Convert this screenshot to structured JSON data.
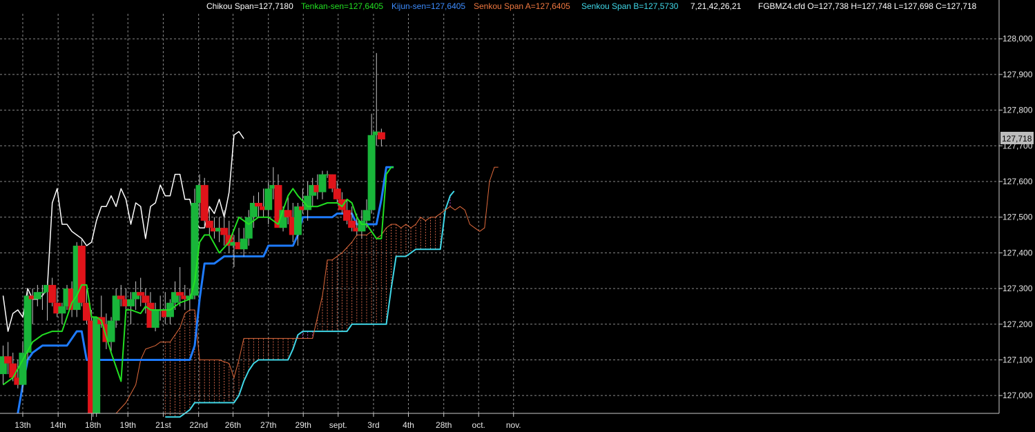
{
  "header": {
    "chikou": "Chikou Span=127,7180",
    "tenkan": "Tenkan-sen=127,6405",
    "kijun": "Kijun-sen=127,6405",
    "senkou_a": "Senkou Span A=127,6405",
    "senkou_b": "Senkou Span B=127,5730",
    "params": "7,21,42,26,21",
    "ohlc": "FGBMZ4.cfd O=127,738 H=127,748 L=127,698 C=127,718"
  },
  "last_price_label": "127,718",
  "colors": {
    "background": "#000000",
    "grid": "#8a8a8a",
    "bull": "#19b53a",
    "bear": "#e0141a",
    "chikou": "#ffffff",
    "tenkan": "#22e022",
    "kijun": "#1e7bff",
    "senkou_a": "#e06a3c",
    "senkou_b": "#40d8e8",
    "cloud_hatch_a": "#d06448",
    "cloud_hatch_b": "#b040c8"
  },
  "chart_data": {
    "type": "candlestick",
    "symbol": "FGBMZ4.cfd",
    "ylim": [
      126.95,
      128.07
    ],
    "y_ticks": [
      127.0,
      127.1,
      127.2,
      127.3,
      127.4,
      127.5,
      127.6,
      127.7,
      127.8,
      127.9,
      128.0
    ],
    "y_tick_labels": [
      "127,000",
      "127,100",
      "127,200",
      "127,300",
      "127,400",
      "127,500",
      "127,600",
      "127,700",
      "127,800",
      "127,900",
      "128,000"
    ],
    "x_labels": [
      {
        "label": "13th",
        "i": 4
      },
      {
        "label": "14th",
        "i": 11.2
      },
      {
        "label": "18th",
        "i": 18.3
      },
      {
        "label": "19th",
        "i": 25.4
      },
      {
        "label": "21st",
        "i": 32.6
      },
      {
        "label": "22nd",
        "i": 39.8
      },
      {
        "label": "26th",
        "i": 46.8
      },
      {
        "label": "27th",
        "i": 54
      },
      {
        "label": "29th",
        "i": 61.1
      },
      {
        "label": "sept.",
        "i": 68.2
      },
      {
        "label": "3rd",
        "i": 75.4
      },
      {
        "label": "4th",
        "i": 82.5
      },
      {
        "label": "28th",
        "i": 89.7
      },
      {
        "label": "oct.",
        "i": 96.8
      },
      {
        "label": "nov.",
        "i": 103.9
      }
    ],
    "candles": [
      {
        "o": 127.06,
        "h": 127.14,
        "l": 127.03,
        "c": 127.11
      },
      {
        "o": 127.11,
        "h": 127.15,
        "l": 127.06,
        "c": 127.09
      },
      {
        "o": 127.09,
        "h": 127.12,
        "l": 127.04,
        "c": 127.05
      },
      {
        "o": 127.05,
        "h": 127.1,
        "l": 127.02,
        "c": 127.03
      },
      {
        "o": 127.03,
        "h": 127.15,
        "l": 127.01,
        "c": 127.12
      },
      {
        "o": 127.12,
        "h": 127.29,
        "l": 127.1,
        "c": 127.28
      },
      {
        "o": 127.28,
        "h": 127.3,
        "l": 127.2,
        "c": 127.27
      },
      {
        "o": 127.27,
        "h": 127.31,
        "l": 127.25,
        "c": 127.29
      },
      {
        "o": 127.29,
        "h": 127.31,
        "l": 127.24,
        "c": 127.29
      },
      {
        "o": 127.29,
        "h": 127.32,
        "l": 127.21,
        "c": 127.31
      },
      {
        "o": 127.31,
        "h": 127.33,
        "l": 127.25,
        "c": 127.26
      },
      {
        "o": 127.26,
        "h": 127.3,
        "l": 127.22,
        "c": 127.23
      },
      {
        "o": 127.23,
        "h": 127.26,
        "l": 127.2,
        "c": 127.25
      },
      {
        "o": 127.25,
        "h": 127.31,
        "l": 127.24,
        "c": 127.3
      },
      {
        "o": 127.3,
        "h": 127.32,
        "l": 127.22,
        "c": 127.24
      },
      {
        "o": 127.24,
        "h": 127.43,
        "l": 127.22,
        "c": 127.42
      },
      {
        "o": 127.42,
        "h": 127.44,
        "l": 127.25,
        "c": 127.26
      },
      {
        "o": 127.26,
        "h": 127.3,
        "l": 127.2,
        "c": 127.21
      },
      {
        "o": 127.21,
        "h": 127.24,
        "l": 126.93,
        "c": 126.95
      },
      {
        "o": 126.95,
        "h": 127.21,
        "l": 126.94,
        "c": 127.22
      },
      {
        "o": 127.22,
        "h": 127.28,
        "l": 127.19,
        "c": 127.2
      },
      {
        "o": 127.2,
        "h": 127.23,
        "l": 127.13,
        "c": 127.15
      },
      {
        "o": 127.15,
        "h": 127.22,
        "l": 127.12,
        "c": 127.21
      },
      {
        "o": 127.21,
        "h": 127.3,
        "l": 127.19,
        "c": 127.28
      },
      {
        "o": 127.28,
        "h": 127.31,
        "l": 127.25,
        "c": 127.27
      },
      {
        "o": 127.27,
        "h": 127.3,
        "l": 127.23,
        "c": 127.25
      },
      {
        "o": 127.25,
        "h": 127.29,
        "l": 127.2,
        "c": 127.27
      },
      {
        "o": 127.27,
        "h": 127.32,
        "l": 127.24,
        "c": 127.29
      },
      {
        "o": 127.29,
        "h": 127.33,
        "l": 127.25,
        "c": 127.28
      },
      {
        "o": 127.28,
        "h": 127.3,
        "l": 127.23,
        "c": 127.26
      },
      {
        "o": 127.26,
        "h": 127.29,
        "l": 127.19,
        "c": 127.19
      },
      {
        "o": 127.19,
        "h": 127.26,
        "l": 127.18,
        "c": 127.24
      },
      {
        "o": 127.24,
        "h": 127.28,
        "l": 127.21,
        "c": 127.24
      },
      {
        "o": 127.24,
        "h": 127.29,
        "l": 127.2,
        "c": 127.22
      },
      {
        "o": 127.22,
        "h": 127.27,
        "l": 127.2,
        "c": 127.26
      },
      {
        "o": 127.26,
        "h": 127.32,
        "l": 127.24,
        "c": 127.29
      },
      {
        "o": 127.29,
        "h": 127.36,
        "l": 127.25,
        "c": 127.28
      },
      {
        "o": 127.28,
        "h": 127.31,
        "l": 127.24,
        "c": 127.27
      },
      {
        "o": 127.27,
        "h": 127.3,
        "l": 127.24,
        "c": 127.28
      },
      {
        "o": 127.28,
        "h": 127.58,
        "l": 127.27,
        "c": 127.54
      },
      {
        "o": 127.54,
        "h": 127.62,
        "l": 127.5,
        "c": 127.59
      },
      {
        "o": 127.59,
        "h": 127.61,
        "l": 127.47,
        "c": 127.49
      },
      {
        "o": 127.49,
        "h": 127.52,
        "l": 127.45,
        "c": 127.47
      },
      {
        "o": 127.47,
        "h": 127.5,
        "l": 127.44,
        "c": 127.46
      },
      {
        "o": 127.46,
        "h": 127.5,
        "l": 127.43,
        "c": 127.47
      },
      {
        "o": 127.47,
        "h": 127.52,
        "l": 127.42,
        "c": 127.45
      },
      {
        "o": 127.45,
        "h": 127.49,
        "l": 127.4,
        "c": 127.42
      },
      {
        "o": 127.42,
        "h": 127.45,
        "l": 127.36,
        "c": 127.43
      },
      {
        "o": 127.43,
        "h": 127.47,
        "l": 127.41,
        "c": 127.41
      },
      {
        "o": 127.41,
        "h": 127.47,
        "l": 127.39,
        "c": 127.44
      },
      {
        "o": 127.44,
        "h": 127.52,
        "l": 127.42,
        "c": 127.5
      },
      {
        "o": 127.5,
        "h": 127.56,
        "l": 127.47,
        "c": 127.54
      },
      {
        "o": 127.54,
        "h": 127.57,
        "l": 127.5,
        "c": 127.53
      },
      {
        "o": 127.53,
        "h": 127.58,
        "l": 127.5,
        "c": 127.52
      },
      {
        "o": 127.52,
        "h": 127.6,
        "l": 127.48,
        "c": 127.58
      },
      {
        "o": 127.58,
        "h": 127.64,
        "l": 127.55,
        "c": 127.59
      },
      {
        "o": 127.59,
        "h": 127.62,
        "l": 127.55,
        "c": 127.47
      },
      {
        "o": 127.47,
        "h": 127.53,
        "l": 127.46,
        "c": 127.52
      },
      {
        "o": 127.52,
        "h": 127.56,
        "l": 127.48,
        "c": 127.5
      },
      {
        "o": 127.5,
        "h": 127.54,
        "l": 127.43,
        "c": 127.45
      },
      {
        "o": 127.45,
        "h": 127.54,
        "l": 127.42,
        "c": 127.53
      },
      {
        "o": 127.53,
        "h": 127.58,
        "l": 127.51,
        "c": 127.52
      },
      {
        "o": 127.52,
        "h": 127.6,
        "l": 127.49,
        "c": 127.56
      },
      {
        "o": 127.56,
        "h": 127.61,
        "l": 127.53,
        "c": 127.59
      },
      {
        "o": 127.59,
        "h": 127.62,
        "l": 127.55,
        "c": 127.57
      },
      {
        "o": 127.57,
        "h": 127.63,
        "l": 127.55,
        "c": 127.62
      },
      {
        "o": 127.62,
        "h": 127.63,
        "l": 127.61,
        "c": 127.62
      },
      {
        "o": 127.62,
        "h": 127.62,
        "l": 127.57,
        "c": 127.58
      },
      {
        "o": 127.58,
        "h": 127.6,
        "l": 127.54,
        "c": 127.55
      },
      {
        "o": 127.55,
        "h": 127.57,
        "l": 127.51,
        "c": 127.52
      },
      {
        "o": 127.52,
        "h": 127.55,
        "l": 127.48,
        "c": 127.49
      },
      {
        "o": 127.49,
        "h": 127.53,
        "l": 127.46,
        "c": 127.47
      },
      {
        "o": 127.47,
        "h": 127.51,
        "l": 127.45,
        "c": 127.46
      },
      {
        "o": 127.46,
        "h": 127.52,
        "l": 127.44,
        "c": 127.49
      },
      {
        "o": 127.49,
        "h": 127.55,
        "l": 127.47,
        "c": 127.52
      },
      {
        "o": 127.52,
        "h": 127.79,
        "l": 127.51,
        "c": 127.73
      },
      {
        "o": 127.73,
        "h": 127.96,
        "l": 127.7,
        "c": 127.74
      },
      {
        "o": 127.738,
        "h": 127.748,
        "l": 127.698,
        "c": 127.718
      }
    ],
    "tenkan": [
      [
        0,
        127.03
      ],
      [
        2,
        127.05
      ],
      [
        4,
        127.1
      ],
      [
        6,
        127.15
      ],
      [
        8,
        127.17
      ],
      [
        10,
        127.18
      ],
      [
        12,
        127.18
      ],
      [
        14,
        127.26
      ],
      [
        15,
        127.28
      ],
      [
        16,
        127.31
      ],
      [
        17,
        127.31
      ],
      [
        18,
        127.22
      ],
      [
        19,
        127.22
      ],
      [
        20,
        127.21
      ],
      [
        22,
        127.12
      ],
      [
        24,
        127.04
      ],
      [
        25,
        127.24
      ],
      [
        26,
        127.24
      ],
      [
        28,
        127.23
      ],
      [
        29,
        127.25
      ],
      [
        30,
        127.24
      ],
      [
        32,
        127.24
      ],
      [
        33,
        127.24
      ],
      [
        34,
        127.24
      ],
      [
        36,
        127.26
      ],
      [
        38,
        127.27
      ],
      [
        39,
        127.32
      ],
      [
        40,
        127.43
      ],
      [
        41,
        127.45
      ],
      [
        42,
        127.45
      ],
      [
        44,
        127.4
      ],
      [
        46,
        127.43
      ],
      [
        48,
        127.5
      ],
      [
        50,
        127.48
      ],
      [
        52,
        127.5
      ],
      [
        54,
        127.5
      ],
      [
        56,
        127.48
      ],
      [
        58,
        127.56
      ],
      [
        59,
        127.58
      ],
      [
        60,
        127.56
      ],
      [
        62,
        127.53
      ],
      [
        64,
        127.53
      ],
      [
        66,
        127.54
      ],
      [
        68,
        127.54
      ],
      [
        69,
        127.53
      ],
      [
        70,
        127.55
      ],
      [
        71,
        127.54
      ],
      [
        72,
        127.5
      ],
      [
        73,
        127.48
      ],
      [
        74,
        127.48
      ],
      [
        76,
        127.44
      ],
      [
        77,
        127.44
      ],
      [
        78,
        127.62
      ],
      [
        79,
        127.64
      ],
      [
        79.5,
        127.64
      ]
    ],
    "kijun": [
      [
        3,
        126.95
      ],
      [
        4,
        127.03
      ],
      [
        5,
        127.1
      ],
      [
        6,
        127.12
      ],
      [
        7,
        127.13
      ],
      [
        8,
        127.14
      ],
      [
        13,
        127.14
      ],
      [
        15,
        127.18
      ],
      [
        16,
        127.18
      ],
      [
        17,
        127.1
      ],
      [
        31,
        127.1
      ],
      [
        38,
        127.1
      ],
      [
        39,
        127.14
      ],
      [
        40,
        127.27
      ],
      [
        41,
        127.37
      ],
      [
        43,
        127.37
      ],
      [
        44,
        127.38
      ],
      [
        45,
        127.39
      ],
      [
        50,
        127.39
      ],
      [
        53,
        127.39
      ],
      [
        54,
        127.42
      ],
      [
        59,
        127.42
      ],
      [
        60,
        127.45
      ],
      [
        61,
        127.5
      ],
      [
        67,
        127.5
      ],
      [
        68,
        127.51
      ],
      [
        71,
        127.51
      ],
      [
        72,
        127.48
      ],
      [
        76,
        127.48
      ],
      [
        77,
        127.55
      ],
      [
        78,
        127.64
      ],
      [
        79.5,
        127.64
      ]
    ],
    "chikou": [
      [
        0,
        127.28
      ],
      [
        1,
        127.18
      ],
      [
        2,
        127.23
      ],
      [
        3,
        127.24
      ],
      [
        4,
        127.22
      ],
      [
        5,
        127.3
      ],
      [
        6,
        127.27
      ],
      [
        7,
        127.27
      ],
      [
        8,
        127.28
      ],
      [
        9,
        127.3
      ],
      [
        10,
        127.54
      ],
      [
        11,
        127.58
      ],
      [
        12,
        127.48
      ],
      [
        13,
        127.48
      ],
      [
        14,
        127.46
      ],
      [
        15,
        127.45
      ],
      [
        16,
        127.44
      ],
      [
        17,
        127.42
      ],
      [
        18,
        127.43
      ],
      [
        19,
        127.49
      ],
      [
        20,
        127.53
      ],
      [
        21,
        127.53
      ],
      [
        22,
        127.56
      ],
      [
        23,
        127.53
      ],
      [
        24,
        127.58
      ],
      [
        25,
        127.55
      ],
      [
        26,
        127.48
      ],
      [
        27,
        127.54
      ],
      [
        28,
        127.53
      ],
      [
        29,
        127.44
      ],
      [
        30,
        127.53
      ],
      [
        31,
        127.54
      ],
      [
        32,
        127.59
      ],
      [
        33,
        127.56
      ],
      [
        34,
        127.56
      ],
      [
        35,
        127.62
      ],
      [
        36,
        127.62
      ],
      [
        37,
        127.55
      ],
      [
        38,
        127.55
      ],
      [
        39,
        127.49
      ],
      [
        40,
        127.47
      ],
      [
        41,
        127.47
      ],
      [
        42,
        127.53
      ],
      [
        43,
        127.51
      ],
      [
        44,
        127.55
      ],
      [
        45,
        127.5
      ],
      [
        46,
        127.57
      ],
      [
        47,
        127.73
      ],
      [
        48,
        127.74
      ],
      [
        49,
        127.72
      ]
    ],
    "senkou_a": [
      [
        23,
        126.95
      ],
      [
        25,
        126.98
      ],
      [
        27,
        127.03
      ],
      [
        28,
        127.1
      ],
      [
        29,
        127.13
      ],
      [
        31,
        127.14
      ],
      [
        32,
        127.15
      ],
      [
        34,
        127.15
      ],
      [
        35,
        127.17
      ],
      [
        36,
        127.19
      ],
      [
        37,
        127.23
      ],
      [
        38,
        127.24
      ],
      [
        39,
        127.24
      ],
      [
        40,
        127.1
      ],
      [
        44,
        127.1
      ],
      [
        46,
        127.09
      ],
      [
        47,
        127.05
      ],
      [
        48,
        127.1
      ],
      [
        49,
        127.16
      ],
      [
        55,
        127.16
      ],
      [
        60,
        127.16
      ],
      [
        63,
        127.16
      ],
      [
        65,
        127.28
      ],
      [
        66,
        127.38
      ],
      [
        67,
        127.38
      ],
      [
        69,
        127.4
      ],
      [
        71,
        127.43
      ],
      [
        72,
        127.45
      ],
      [
        74,
        127.45
      ],
      [
        75,
        127.46
      ],
      [
        76,
        127.44
      ],
      [
        77,
        127.45
      ],
      [
        78,
        127.47
      ],
      [
        79,
        127.48
      ],
      [
        80,
        127.48
      ],
      [
        81,
        127.47
      ],
      [
        82,
        127.48
      ],
      [
        83,
        127.47
      ],
      [
        84,
        127.48
      ],
      [
        85,
        127.5
      ],
      [
        86,
        127.49
      ],
      [
        87,
        127.5
      ],
      [
        88,
        127.5
      ],
      [
        89,
        127.51
      ],
      [
        90,
        127.52
      ],
      [
        91,
        127.53
      ],
      [
        92,
        127.52
      ],
      [
        93,
        127.53
      ],
      [
        94,
        127.52
      ],
      [
        95,
        127.48
      ],
      [
        96,
        127.47
      ],
      [
        97,
        127.46
      ],
      [
        98,
        127.47
      ],
      [
        99,
        127.6
      ],
      [
        100,
        127.64
      ],
      [
        100.8,
        127.64
      ]
    ],
    "senkou_b": [
      [
        33,
        126.94
      ],
      [
        36,
        126.94
      ],
      [
        38,
        126.96
      ],
      [
        39,
        126.98
      ],
      [
        47,
        126.98
      ],
      [
        48,
        127.0
      ],
      [
        49,
        127.04
      ],
      [
        50,
        127.07
      ],
      [
        51,
        127.09
      ],
      [
        52,
        127.1
      ],
      [
        58,
        127.1
      ],
      [
        59,
        127.13
      ],
      [
        60,
        127.17
      ],
      [
        61,
        127.18
      ],
      [
        70,
        127.18
      ],
      [
        71,
        127.2
      ],
      [
        78,
        127.2
      ],
      [
        79,
        127.3
      ],
      [
        80,
        127.39
      ],
      [
        82,
        127.39
      ],
      [
        83,
        127.4
      ],
      [
        84,
        127.41
      ],
      [
        89,
        127.41
      ],
      [
        90,
        127.52
      ],
      [
        91,
        127.56
      ],
      [
        91.8,
        127.573
      ]
    ]
  }
}
